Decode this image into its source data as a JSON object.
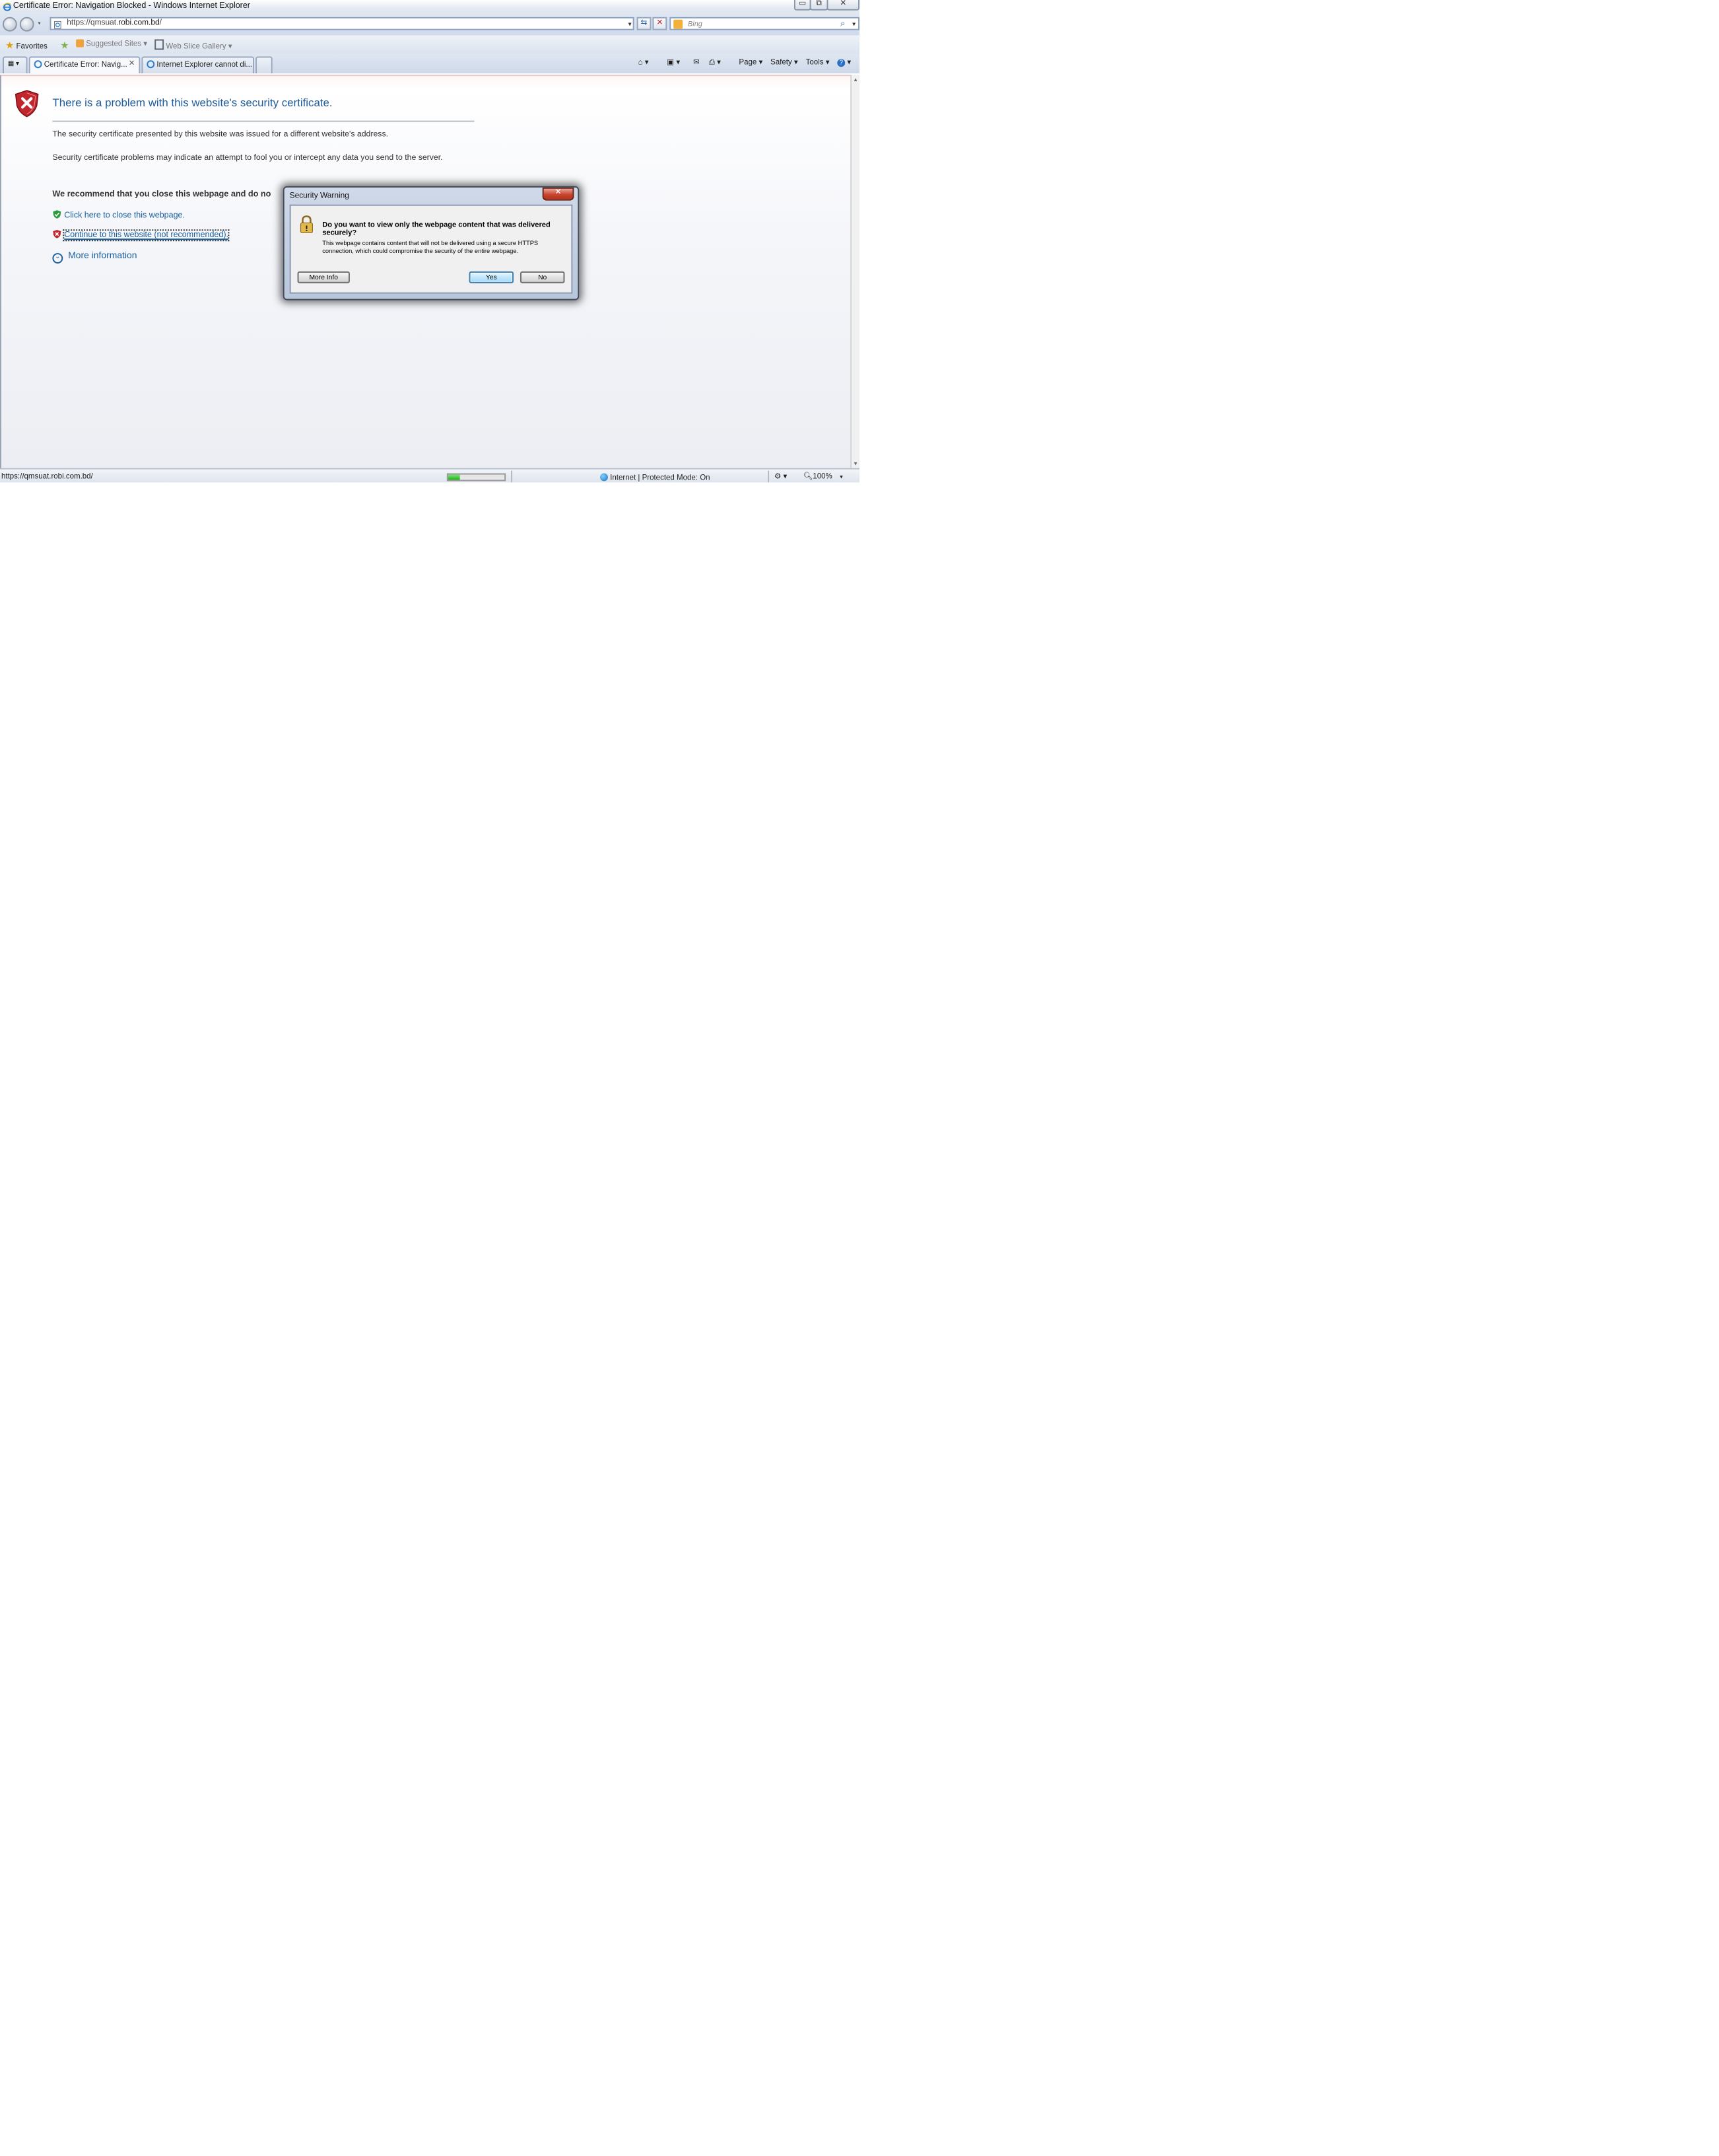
{
  "window": {
    "title": "Certificate Error: Navigation Blocked - Windows Internet Explorer",
    "caption_min": "▭",
    "caption_max": "⧉",
    "caption_close": "✕"
  },
  "navbar": {
    "url_prefix": "https://qmsuat.",
    "url_domain": "robi.com.bd",
    "url_suffix": "/",
    "dropdown_glyph": "▾",
    "refresh_glyph": "⇆",
    "stop_glyph": "✕",
    "search_placeholder": "Bing",
    "search_glyph": "⌕"
  },
  "favorites_bar": {
    "favorites_label": "Favorites",
    "suggested_label": "Suggested Sites ▾",
    "webslice_label": "Web Slice Gallery ▾"
  },
  "tabs": [
    {
      "label": "Certificate Error: Navig...",
      "close": "✕"
    },
    {
      "label": "Internet Explorer cannot di..."
    }
  ],
  "command_bar": {
    "page_label": "Page ▾",
    "safety_label": "Safety ▾",
    "tools_label": "Tools ▾",
    "help_label": "?"
  },
  "page": {
    "heading": "There is a problem with this website's security certificate.",
    "para1": "The security certificate presented by this website was issued for a different website's address.",
    "para2": "Security certificate problems may indicate an attempt to fool you or intercept any data you send to the server.",
    "recommend": "We recommend that you close this webpage and do no",
    "close_link": "Click here to close this webpage.",
    "continue_link": "Continue to this website (not recommended).",
    "more_info": "More information"
  },
  "dialog": {
    "title": "Security Warning",
    "close_glyph": "✕",
    "question": "Do you want to view only the webpage content that was delivered securely?",
    "detail": "This webpage contains content that will not be delivered using a secure HTTPS connection, which could compromise the security of the entire webpage.",
    "more_info_button": "More Info",
    "yes_button": "Yes",
    "no_button": "No"
  },
  "status_bar": {
    "url": "https://qmsuat.robi.com.bd/",
    "zone": "Internet | Protected Mode: On",
    "zoom": "100%",
    "progress": 0.22
  },
  "colors": {
    "link": "#1a5e9c",
    "heading": "#1f5c9a",
    "shield_red": "#c0262c",
    "check_green": "#2a9a3a",
    "dialog_close_red": "#c8452e"
  }
}
